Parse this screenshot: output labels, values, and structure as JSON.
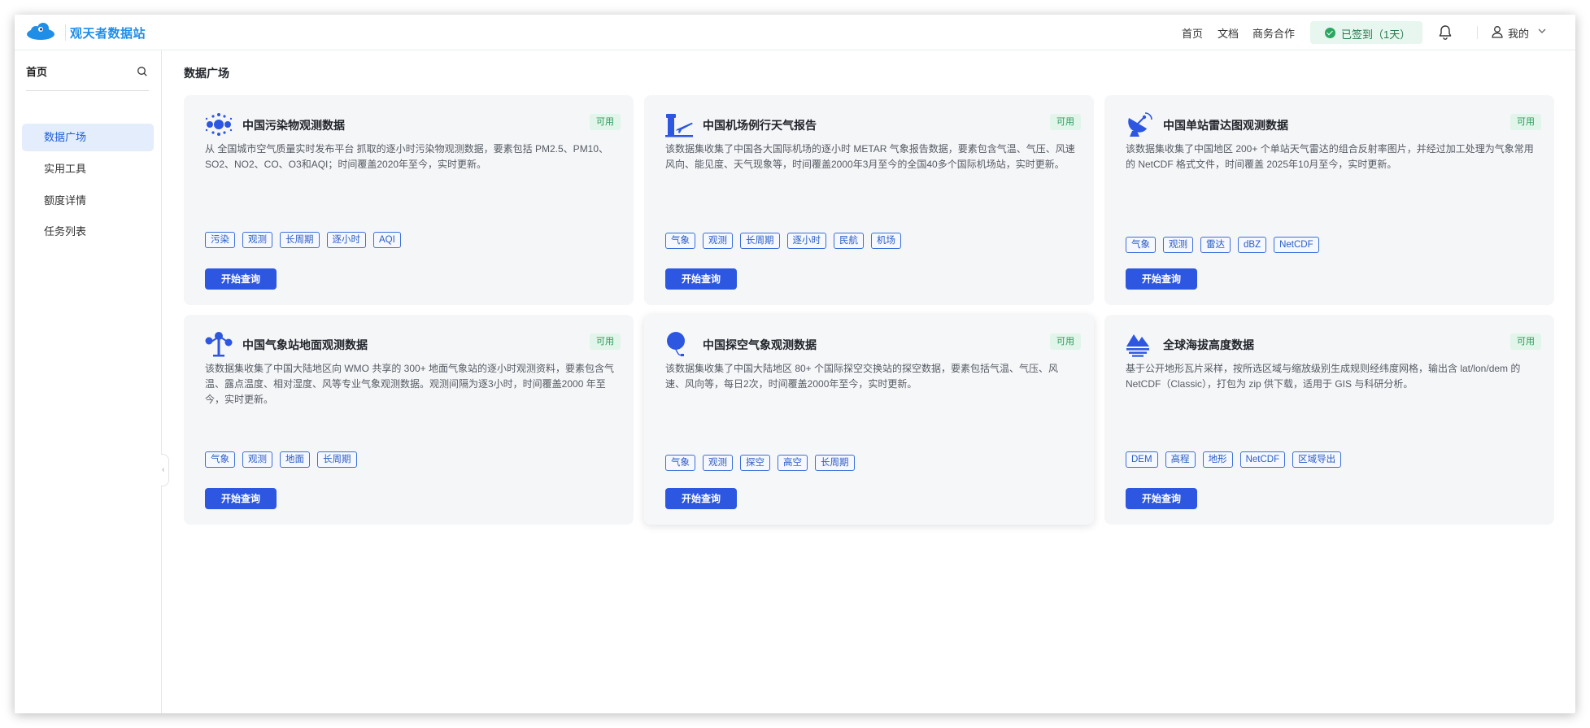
{
  "header": {
    "brand": "观天者数据站",
    "nav": [
      "首页",
      "文档",
      "商务合作"
    ],
    "signin": "已签到（1天）",
    "user": "我的"
  },
  "sidebar": {
    "home": "首页",
    "items": [
      {
        "label": "数据广场",
        "active": true
      },
      {
        "label": "实用工具",
        "active": false
      },
      {
        "label": "额度详情",
        "active": false
      },
      {
        "label": "任务列表",
        "active": false
      }
    ]
  },
  "main": {
    "title": "数据广场",
    "cards": [
      {
        "title": "中国污染物观测数据",
        "badge": "可用",
        "icon": "pollution-particles-icon",
        "desc": "从 全国城市空气质量实时发布平台 抓取的逐小时污染物观测数据，要素包括 PM2.5、PM10、SO2、NO2、CO、O3和AQI；时间覆盖2020年至今，实时更新。",
        "tags": [
          "污染",
          "观测",
          "长周期",
          "逐小时",
          "AQI"
        ],
        "button": "开始查询"
      },
      {
        "title": "中国机场例行天气报告",
        "badge": "可用",
        "icon": "airport-tower-plane-icon",
        "desc": "该数据集收集了中国各大国际机场的逐小时 METAR 气象报告数据，要素包含气温、气压、风速风向、能见度、天气现象等，时间覆盖2000年3月至今的全国40多个国际机场站，实时更新。",
        "tags": [
          "气象",
          "观测",
          "长周期",
          "逐小时",
          "民航",
          "机场"
        ],
        "button": "开始查询"
      },
      {
        "title": "中国单站雷达图观测数据",
        "badge": "可用",
        "icon": "radar-dish-icon",
        "desc": "该数据集收集了中国地区 200+ 个单站天气雷达的组合反射率图片，并经过加工处理为气象常用的 NetCDF 格式文件，时间覆盖 2025年10月至今，实时更新。",
        "tags": [
          "气象",
          "观测",
          "雷达",
          "dBZ",
          "NetCDF"
        ],
        "button": "开始查询"
      },
      {
        "title": "中国气象站地面观测数据",
        "badge": "可用",
        "icon": "weather-station-icon",
        "desc": "该数据集收集了中国大陆地区向 WMO 共享的 300+ 地面气象站的逐小时观测资料，要素包含气温、露点温度、相对湿度、风等专业气象观测数据。观测间隔为逐3小时，时间覆盖2000 年至今，实时更新。",
        "tags": [
          "气象",
          "观测",
          "地面",
          "长周期"
        ],
        "button": "开始查询"
      },
      {
        "title": "中国探空气象观测数据",
        "badge": "可用",
        "icon": "weather-balloon-icon",
        "desc": "该数据集收集了中国大陆地区 80+ 个国际探空交换站的探空数据，要素包括气温、气压、风速、风向等，每日2次，时间覆盖2000年至今，实时更新。",
        "tags": [
          "气象",
          "观测",
          "探空",
          "高空",
          "长周期"
        ],
        "button": "开始查询"
      },
      {
        "title": "全球海拔高度数据",
        "badge": "可用",
        "icon": "mountain-elevation-icon",
        "desc": "基于公开地形瓦片采样，按所选区域与缩放级别生成规则经纬度网格，输出含 lat/lon/dem 的 NetCDF（Classic），打包为 zip 供下载，适用于 GIS 与科研分析。",
        "tags": [
          "DEM",
          "高程",
          "地形",
          "NetCDF",
          "区域导出"
        ],
        "button": "开始查询"
      }
    ]
  },
  "colors": {
    "accent": "#2d57e0",
    "brand": "#1f8ee8",
    "ok": "#2aa861"
  }
}
